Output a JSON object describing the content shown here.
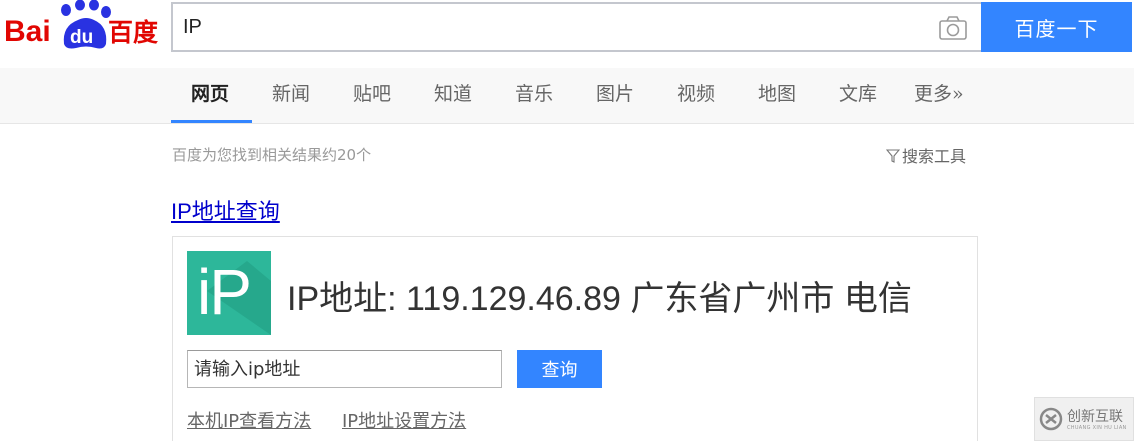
{
  "header": {
    "logo_text_left": "Bai",
    "logo_text_paw": "du",
    "logo_text_right": "百度",
    "search_value": "IP",
    "search_button_label": "百度一下"
  },
  "tabs": [
    {
      "label": "网页",
      "active": true
    },
    {
      "label": "新闻",
      "active": false
    },
    {
      "label": "贴吧",
      "active": false
    },
    {
      "label": "知道",
      "active": false
    },
    {
      "label": "音乐",
      "active": false
    },
    {
      "label": "图片",
      "active": false
    },
    {
      "label": "视频",
      "active": false
    },
    {
      "label": "地图",
      "active": false
    },
    {
      "label": "文库",
      "active": false
    },
    {
      "label": "更多»",
      "active": false
    }
  ],
  "results": {
    "count_text": "百度为您找到相关结果约20个",
    "tools_label": "搜索工具",
    "first_title": "IP地址查询"
  },
  "ip_card": {
    "logo_text": "iP",
    "label": "IP地址: ",
    "ip": "119.129.46.89",
    "location": "广东省广州市",
    "isp": "电信",
    "input_placeholder": "请输入ip地址",
    "query_button": "查询",
    "links": [
      "本机IP查看方法",
      "IP地址设置方法"
    ]
  },
  "watermark": {
    "text": "创新互联",
    "subtext": "CHUANG XIN HU LIAN"
  },
  "colors": {
    "accent": "#3385ff",
    "link": "#0000cc",
    "ip_logo_green": "#2db79a",
    "baidu_red": "#e10602",
    "baidu_blue": "#2932e1"
  }
}
